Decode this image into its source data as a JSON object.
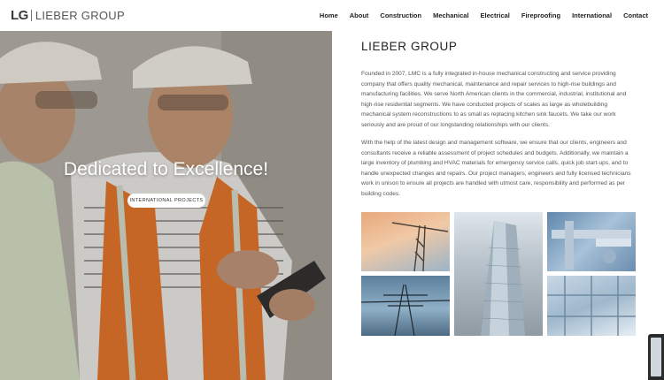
{
  "brand": {
    "mark": "LG",
    "name": "LIEBER GROUP"
  },
  "nav": {
    "items": [
      {
        "label": "Home"
      },
      {
        "label": "About"
      },
      {
        "label": "Construction"
      },
      {
        "label": "Mechanical"
      },
      {
        "label": "Electrical"
      },
      {
        "label": "Fireproofing"
      },
      {
        "label": "International"
      },
      {
        "label": "Contact"
      }
    ]
  },
  "hero": {
    "title": "Dedicated to Excellence!",
    "button_label": "INTERNATIONAL PROJECTS"
  },
  "content": {
    "title": "LIEBER GROUP",
    "paragraph_1": "Founded in 2007, LMC is a fully integrated in-house mechanical constructing and service providing company that offers quality mechanical, maintenance and repair services to high-rise buildings and manufacturing facilities. We serve North American clients in the commercial, industrial, institutional and high-rise residential segments. We have conducted projects of scales as large as wholebuilding mechanical system reconstructions to as small as replacing kitchen sink faucets. We take our work seriously and are proud of our longstanding relationships with our clients.",
    "paragraph_2": "With the help of the latest design and management software, we ensure that our clients, engineers and consultants receive a reliable assessment of project schedules and budgets. Additionally, we maintain a large inventory of plumbing and HVAC materials for emergency service calls, quick job start-ups, and to handle unexpected changes and repairs. Our project managers, engineers and fully licensed technicians work in unison to ensure all projects are handled with utmost care, responsibility and performed as per building codes."
  },
  "gallery": {
    "images": [
      {
        "icon": "construction-crane-image"
      },
      {
        "icon": "skyscraper-image"
      },
      {
        "icon": "hvac-pipes-image"
      },
      {
        "icon": "power-pylon-image"
      },
      {
        "icon": "steel-structure-image"
      }
    ]
  },
  "colors": {
    "text_dark": "#222222",
    "text_body": "#555555",
    "button_bg": "#ffffff"
  }
}
